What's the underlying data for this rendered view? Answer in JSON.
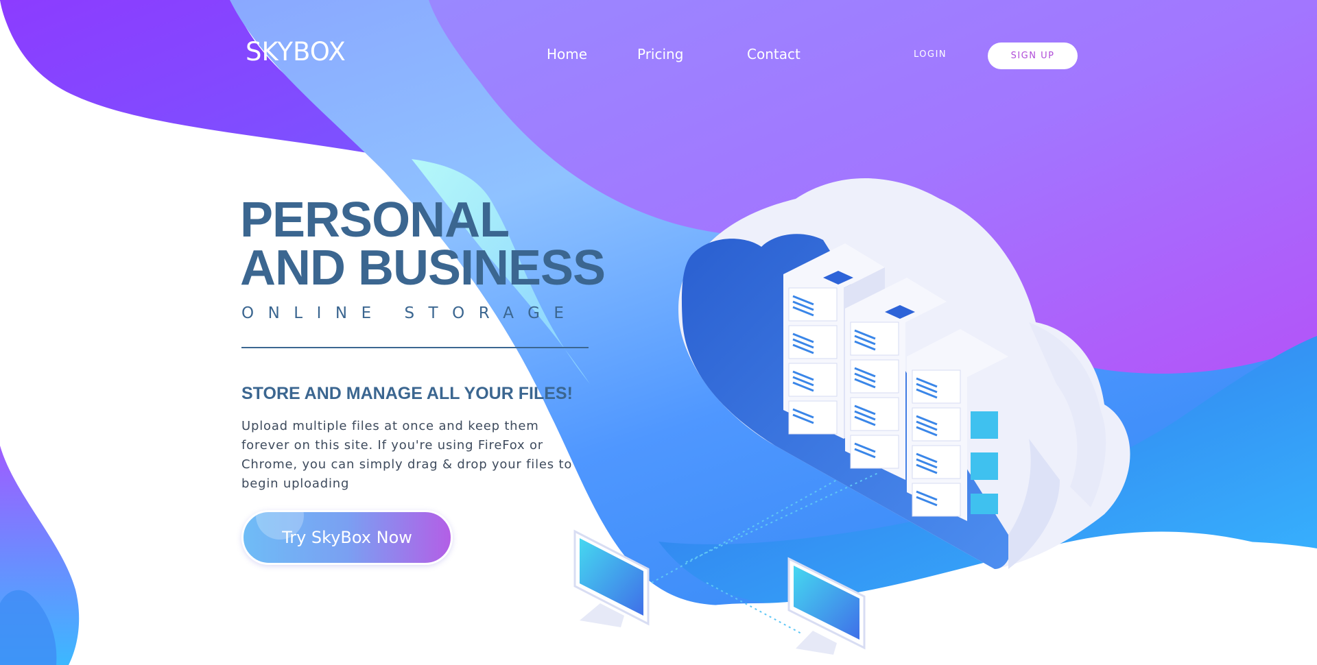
{
  "brand": {
    "logo": "SKYBOX"
  },
  "nav": {
    "links": [
      "Home",
      "Pricing",
      "Contact"
    ],
    "login_label": "LOGIN",
    "signup_label": "SIGN UP"
  },
  "hero": {
    "headline_line1": "PERSONAL",
    "headline_line2": "AND BUSINESS",
    "subheading": "ONLINE STORAGE",
    "section_heading": "STORE AND MANAGE ALL YOUR FILES!",
    "body": "Upload multiple files at once and keep them forever on this site. If you're using FireFox or Chrome, you can simply drag & drop your files to begin uploading",
    "cta_label": "Try SkyBox Now"
  },
  "illustration": {
    "icons": [
      "cloud-icon",
      "server-rack-icon",
      "monitor-icon"
    ]
  },
  "colors": {
    "heading": "#3b6690",
    "purple": "#8b4dff",
    "blue": "#3fa0ff",
    "cta_start": "#6fbcf6",
    "cta_end": "#b35fe6",
    "signup_text": "#b04dd8"
  }
}
